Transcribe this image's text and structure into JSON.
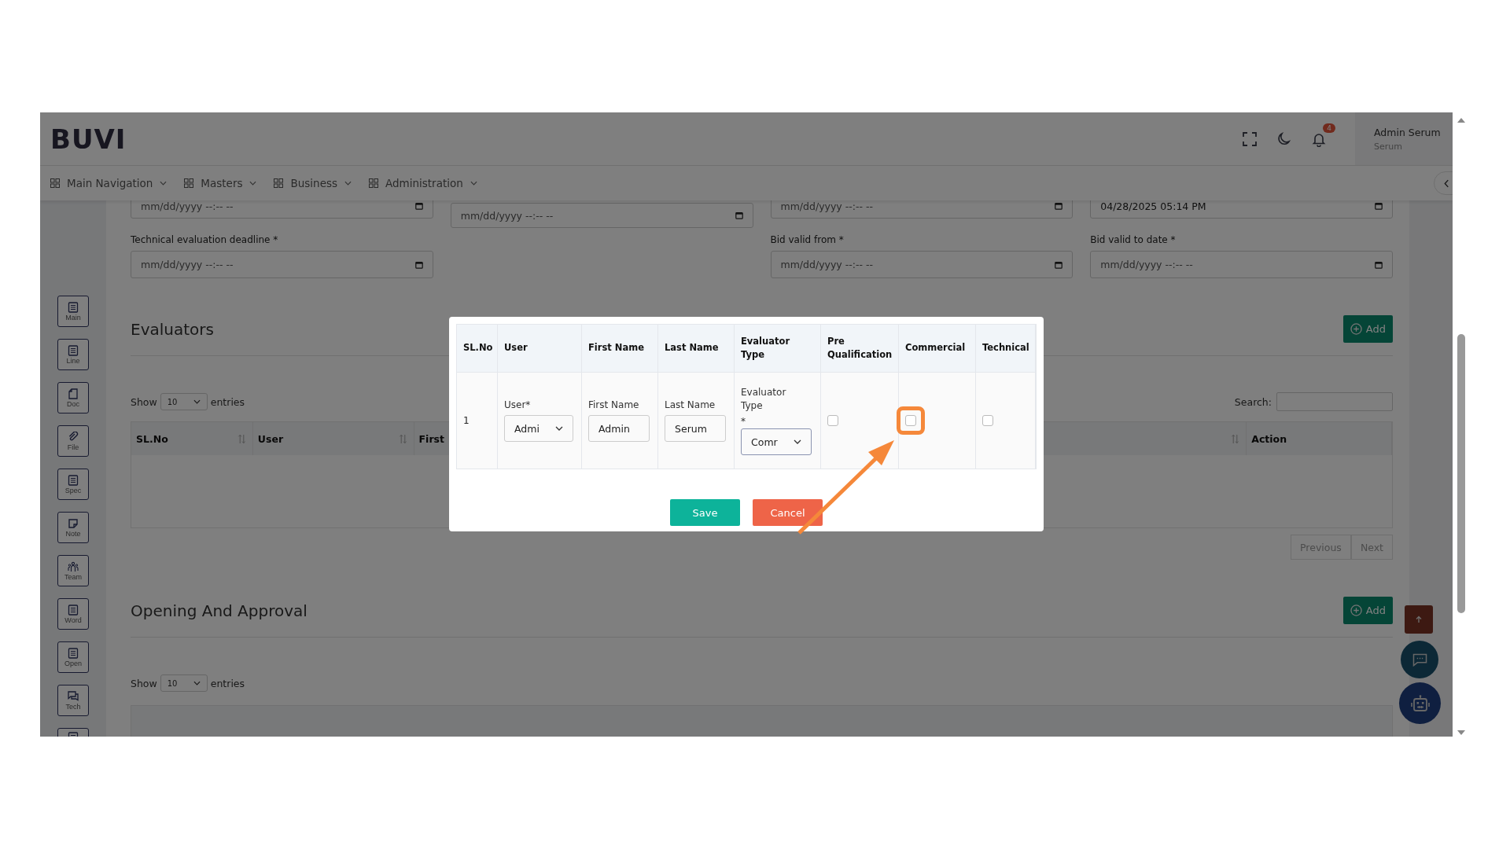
{
  "header": {
    "logo": "BUVI",
    "notification_count": "4",
    "user_name": "Admin Serum",
    "user_role": "Serum"
  },
  "nav": [
    {
      "label": "Main Navigation"
    },
    {
      "label": "Masters"
    },
    {
      "label": "Business"
    },
    {
      "label": "Administration"
    }
  ],
  "sidebar": [
    {
      "kind": "list",
      "label": "Main"
    },
    {
      "kind": "list",
      "label": "Line"
    },
    {
      "kind": "doc",
      "label": "Doc"
    },
    {
      "kind": "clip",
      "label": "File"
    },
    {
      "kind": "list",
      "label": "Spec"
    },
    {
      "kind": "note",
      "label": "Note"
    },
    {
      "kind": "team",
      "label": "Team"
    },
    {
      "kind": "list",
      "label": "Word"
    },
    {
      "kind": "list",
      "label": "Open"
    },
    {
      "kind": "chat",
      "label": "Tech"
    },
    {
      "kind": "list"
    }
  ],
  "date_rows": [
    {
      "fields": [
        {
          "value": "mm/dd/yyyy --:-- --",
          "filled": false
        },
        {
          "value": "mm/dd/yyyy --:-- --",
          "filled": false
        },
        {
          "value": "mm/dd/yyyy --:-- --",
          "filled": false
        },
        {
          "value": "04/28/2025 05:14 PM",
          "filled": true
        }
      ]
    },
    {
      "fields": [
        {
          "label": "Technical evaluation deadline *",
          "value": "mm/dd/yyyy --:-- --",
          "filled": false
        },
        {
          "label": "Bid valid from *",
          "value": "mm/dd/yyyy --:-- --",
          "filled": false
        },
        {
          "label": "Bid valid to date *",
          "value": "mm/dd/yyyy --:-- --",
          "filled": false
        }
      ]
    }
  ],
  "evaluators": {
    "title": "Evaluators",
    "add_button": "Add",
    "show": "Show",
    "page_size": "10",
    "entries": "entries",
    "search_label": "Search:",
    "columns": [
      {
        "label": "SL.No",
        "sortable": true
      },
      {
        "label": "User",
        "sortable": true
      },
      {
        "label": "First",
        "sortable": true
      },
      {
        "label": "Action",
        "sortable": false
      }
    ],
    "pagination": [
      {
        "label": "Previous",
        "disabled": true
      },
      {
        "label": "Next",
        "disabled": true
      }
    ]
  },
  "opening": {
    "title": "Opening And Approval",
    "add_button": "Add",
    "show": "Show",
    "page_size": "10",
    "entries": "entries"
  },
  "modal": {
    "columns": [
      {
        "label": "SL.No"
      },
      {
        "label": "User"
      },
      {
        "label": "First Name"
      },
      {
        "label": "Last Name"
      },
      {
        "label": "Evaluator Type"
      },
      {
        "label": "Pre Qualification"
      },
      {
        "label": "Commercial"
      },
      {
        "label": "Technical"
      }
    ],
    "row": {
      "sl": "1",
      "user_label": "User*",
      "user_value": "Admi",
      "first_label": "First Name",
      "first_value": "Admin",
      "last_label": "Last Name",
      "last_value": "Serum",
      "type_label": "Evaluator Type",
      "type_required": "*",
      "type_value": "Comr",
      "checks": [
        {
          "checked": false,
          "highlighted": false
        },
        {
          "checked": false,
          "highlighted": true
        },
        {
          "checked": false,
          "highlighted": false
        }
      ]
    },
    "buttons": [
      {
        "kind": "save",
        "label": "Save"
      },
      {
        "kind": "cancel",
        "label": "Cancel"
      }
    ]
  }
}
